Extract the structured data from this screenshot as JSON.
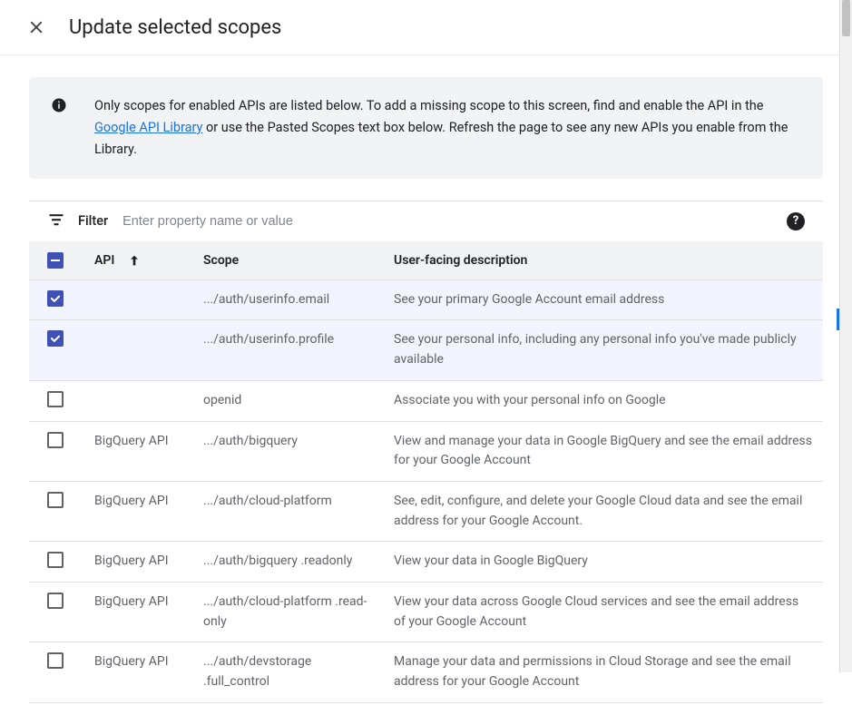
{
  "header": {
    "title": "Update selected scopes"
  },
  "info": {
    "text_before_link": "Only scopes for enabled APIs are listed below. To add a missing scope to this screen, find and enable the API in the ",
    "link_text": "Google API Library",
    "text_after_link": " or use the Pasted Scopes text box below. Refresh the page to see any new APIs you enable from the Library."
  },
  "filter": {
    "label": "Filter",
    "placeholder": "Enter property name or value"
  },
  "columns": {
    "api": "API",
    "scope": "Scope",
    "description": "User-facing description"
  },
  "rows": [
    {
      "selected": true,
      "api": "",
      "scope": ".../auth/userinfo.email",
      "description": "See your primary Google Account email address"
    },
    {
      "selected": true,
      "api": "",
      "scope": ".../auth/userinfo.profile",
      "description": "See your personal info, including any personal info you've made publicly available"
    },
    {
      "selected": false,
      "api": "",
      "scope": "openid",
      "description": "Associate you with your personal info on Google"
    },
    {
      "selected": false,
      "api": "BigQuery API",
      "scope": ".../auth/bigquery",
      "description": "View and manage your data in Google BigQuery and see the email address for your Google Account"
    },
    {
      "selected": false,
      "api": "BigQuery API",
      "scope": ".../auth/cloud-platform",
      "description": "See, edit, configure, and delete your Google Cloud data and see the email address for your Google Account."
    },
    {
      "selected": false,
      "api": "BigQuery API",
      "scope": ".../auth/bigquery .readonly",
      "description": "View your data in Google BigQuery"
    },
    {
      "selected": false,
      "api": "BigQuery API",
      "scope": ".../auth/cloud-platform .read-only",
      "description": "View your data across Google Cloud services and see the email address of your Google Account"
    },
    {
      "selected": false,
      "api": "BigQuery API",
      "scope": ".../auth/devstorage .full_control",
      "description": "Manage your data and permissions in Cloud Storage and see the email address for your Google Account"
    }
  ]
}
